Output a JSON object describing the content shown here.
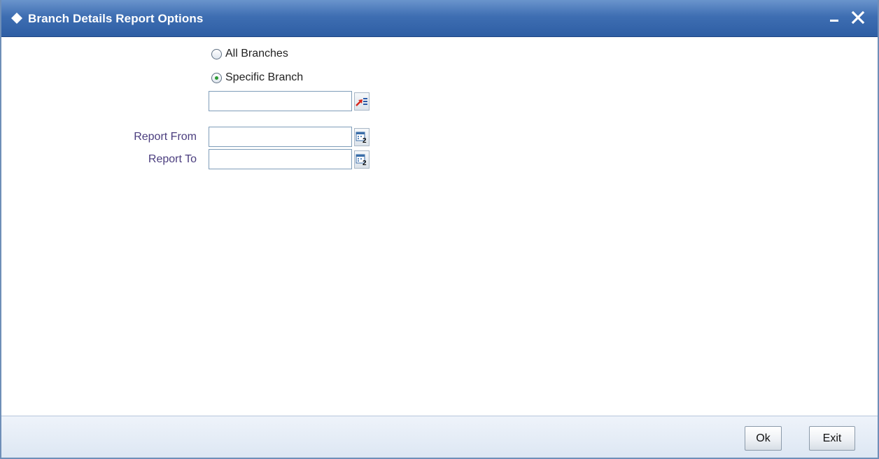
{
  "window": {
    "title": "Branch Details Report Options",
    "minimize_symbol": "_",
    "close_symbol": "✕"
  },
  "branch_options": [
    {
      "label": "All Branches",
      "selected": false
    },
    {
      "label": "Specific Branch",
      "selected": true
    }
  ],
  "branch_input": {
    "value": "",
    "lov_icon": "list-of-values-icon"
  },
  "report_from": {
    "label": "Report From",
    "value": "",
    "icon": "calendar-icon"
  },
  "report_to": {
    "label": "Report To",
    "value": "",
    "icon": "calendar-icon"
  },
  "footer": {
    "ok_label": "Ok",
    "exit_label": "Exit"
  },
  "colors": {
    "titlebar": "#3e6eb2",
    "label_text": "#4a3d7e",
    "footer_bg": "#e6edf7"
  }
}
